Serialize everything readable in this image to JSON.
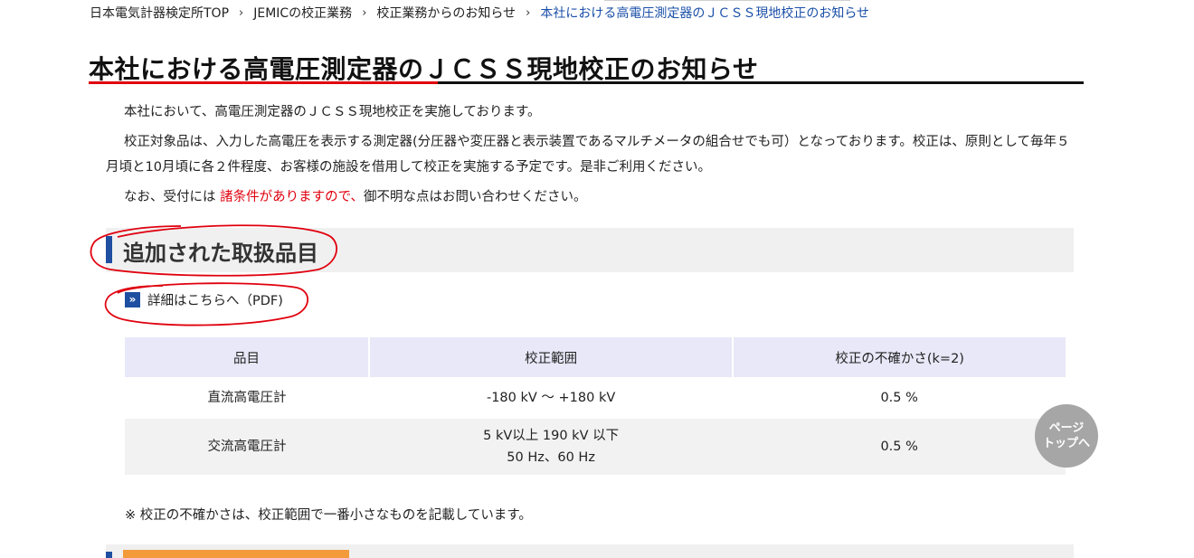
{
  "breadcrumb": {
    "items": [
      "日本電気計器検定所TOP",
      "JEMICの校正業務",
      "校正業務からのお知らせ"
    ],
    "current": "本社における高電圧測定器のＪＣＳＳ現地校正のお知らせ",
    "separator": "›"
  },
  "page": {
    "title": "本社における高電圧測定器のＪＣＳＳ現地校正のお知らせ"
  },
  "intro": {
    "p1": "本社において、高電圧測定器のＪＣＳＳ現地校正を実施しております。",
    "p2": "校正対象品は、入力した高電圧を表示する測定器(分圧器や変圧器と表示装置であるマルチメータの組合せでも可）となっております。校正は、原則として毎年５月頃と10月頃に各２件程度、お客様の施設を借用して校正を実施する予定です。是非ご利用ください。",
    "p3_before": "なお、受付には ",
    "p3_red": "諸条件がありますので、",
    "p3_after": "御不明な点はお問い合わせください。"
  },
  "section": {
    "title": "追加された取扱品目",
    "pdf_link_label": "詳細はこちらへ（PDF)",
    "pdf_icon_glyph": "»"
  },
  "table": {
    "headers": [
      "品目",
      "校正範囲",
      "校正の不確かさ(k=2)"
    ],
    "rows": [
      {
        "item": "直流高電圧計",
        "range_line1": "-180 kV 〜 +180 kV",
        "range_line2": "",
        "uncertainty": "0.5 %"
      },
      {
        "item": "交流高電圧計",
        "range_line1": "5 kV以上 190 kV 以下",
        "range_line2": "50 Hz、60 Hz",
        "uncertainty": "0.5 %"
      }
    ]
  },
  "note": "※ 校正の不確かさは、校正範囲で一番小さなものを記載しています。",
  "page_top": {
    "line1": "ページ",
    "line2": "トップへ"
  },
  "colors": {
    "accent_blue": "#1e4fa0",
    "link_blue": "#1a4fa8",
    "red": "#e0000e",
    "orange": "#f39a3a",
    "annotation_red": "#e0000e"
  }
}
